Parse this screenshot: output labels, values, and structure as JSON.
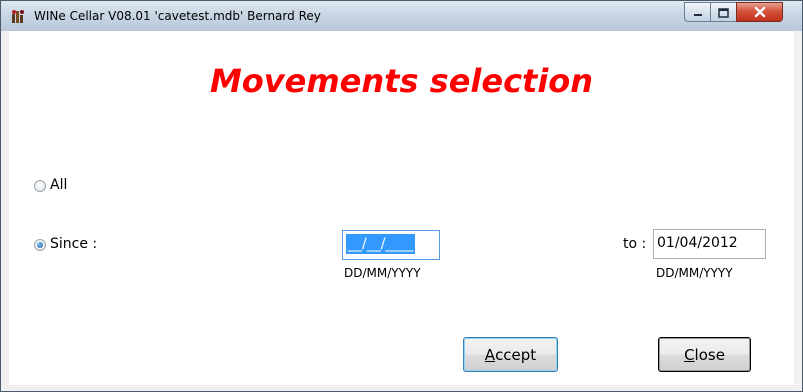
{
  "window": {
    "title": "WINe Cellar V08.01 'cavetest.mdb'   Bernard Rey",
    "icon": "wine-cellar-app-icon",
    "controls": {
      "minimize": "minimize-icon",
      "maximize": "maximize-icon",
      "close": "close-icon"
    }
  },
  "form": {
    "heading": "Movements selection",
    "options": {
      "all_label": "All",
      "all_selected": false,
      "since_label": "Since :",
      "since_selected": true
    },
    "since_date": {
      "value": "__/__/____",
      "format_hint": "DD/MM/YYYY"
    },
    "to_label": "to :",
    "to_date": {
      "value": "01/04/2012",
      "format_hint": "DD/MM/YYYY"
    },
    "buttons": {
      "accept_mnemonic": "A",
      "accept_rest": "ccept",
      "close_mnemonic": "C",
      "close_rest": "lose"
    }
  },
  "colors": {
    "heading": "#ff0000",
    "selection": "#3399ff",
    "close_button": "#c3301c"
  }
}
